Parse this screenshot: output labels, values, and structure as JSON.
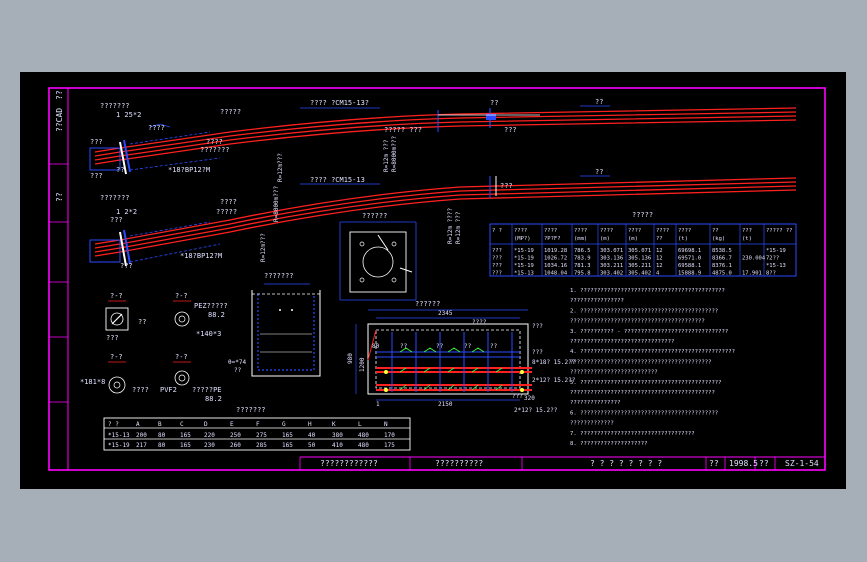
{
  "colors": {
    "frame": "#ff00ff",
    "cable": "#ff2020",
    "dim": "#2a4bff",
    "text": "#e0e0ff",
    "green": "#3cff3c",
    "yellow": "#ffff40",
    "white": "#ffffff",
    "bg": "#000000"
  },
  "side_titles": [
    "??CAD",
    "??",
    "??"
  ],
  "top_labels": {
    "a1": "???????",
    "a2": "1 25*2",
    "a3": "?????",
    "a4": "????",
    "a5": "????",
    "a6": "???????",
    "a7": "???? ?CM15-13?",
    "a8": "????? ???",
    "a9": "???",
    "a10": "*18?BP12?M",
    "a11": "???",
    "a12": "??",
    "a13": "??",
    "a14": "???",
    "a15": "??"
  },
  "mid_labels": {
    "b1": "???????",
    "b2": "1 2*2",
    "b3": "????",
    "b4": "?????",
    "b5": "???? ?CM15-13",
    "b6": "???",
    "b7": "???",
    "b8": "*18?BP12?M",
    "b9": "???",
    "b10": "??"
  },
  "vertical_labels": [
    "R=12m???",
    "R=12m ???",
    "R=8000m???",
    "R=12m???",
    "R=12m ????",
    "R=12m ???",
    "R=8000m???"
  ],
  "plate_label": "??????",
  "sections": {
    "s1": "?-?",
    "s2": "?-?",
    "s3": "?-?",
    "s4": "?-?",
    "s1a": "???",
    "s1b": "??",
    "s2a": "PEZ?????",
    "s2b": "88.2",
    "s2c": "*140*3",
    "s3a": "*181*8",
    "s3b": "????",
    "s4a": "PVF2",
    "s4b": "?????PE",
    "s4c": "88.2",
    "tub_title": "???????",
    "tub_a": "θ=*74",
    "tub_b": "??"
  },
  "plan_title": "??????",
  "plan_dims": [
    "2345",
    "2150",
    "980",
    "1200",
    "320"
  ],
  "plan_labels": [
    "????",
    "??",
    "??",
    "??",
    "??",
    "80",
    "8*18? 15.2??",
    "2*12? 15.2??",
    "2*12? 15.2??",
    "???",
    "1",
    "???",
    "???"
  ],
  "top_table": {
    "title": "?????",
    "headers": [
      "? ?",
      "????",
      "????",
      "????",
      "????",
      "????",
      "????",
      "????",
      "??",
      "???",
      "????? ??"
    ],
    "units": [
      "",
      "(MP?)",
      "?P?F?",
      "(mm)",
      "(m)",
      "(m)",
      "??",
      "(t)",
      "(kg)",
      "(t)",
      ""
    ],
    "rows": [
      [
        "???",
        "*15-19",
        "1019.28",
        "786.5",
        "303.071",
        "305.071",
        "12",
        "69698.1",
        "8538.5",
        "",
        "*15-19"
      ],
      [
        "???",
        "*15-19",
        "1026.72",
        "783.9",
        "303.136",
        "305.136",
        "12",
        "69571.0",
        "8366.7",
        "230.004",
        "72??"
      ],
      [
        "???",
        "*15-19",
        "1034.16",
        "781.3",
        "303.211",
        "305.211",
        "12",
        "69588.1",
        "8376.1",
        "",
        "*15-13"
      ],
      [
        "???",
        "*15-13",
        "1048.04",
        "795.8",
        "303.402",
        "305.402",
        "4",
        "15888.9",
        "4875.0",
        "17.901",
        "8??"
      ]
    ]
  },
  "notes": [
    "1. ???????????????????????????????????????????",
    "   ????????????????",
    "2. ?????????????????????????????????????????",
    "   ????????????????????????????????????????",
    "3. ?????????? - ???????????????????????????????",
    "   ???????????????????????????????",
    "4. ??????????????????????????????????????????????",
    "   ??????????????????????????????????????????",
    "   ??????????????????????????",
    "5. ??????????????????????????????????????????",
    "   ???????????????????????????????????????????",
    "   ???????????????",
    "6. ?????????????????????????????????????????",
    "   ?????????????",
    "7. ??????????????????????????????????",
    "8. ????????????????????"
  ],
  "bottom_table": {
    "title": "???????",
    "headers": [
      "? ?",
      "A",
      "B",
      "C",
      "D",
      "E",
      "F",
      "G",
      "H",
      "K",
      "L",
      "N"
    ],
    "rows": [
      [
        "*15-13",
        "200",
        "80",
        "165",
        "220",
        "250",
        "275",
        "165",
        "40",
        "380",
        "480",
        "170"
      ],
      [
        "*15-19",
        "217",
        "80",
        "165",
        "230",
        "260",
        "285",
        "165",
        "50",
        "410",
        "480",
        "175"
      ]
    ]
  },
  "title_block": {
    "name1": "????????????",
    "name2": "??????????",
    "blank": "? ? ? ? ? ? ? ?",
    "c1": "??",
    "date": "1998.5",
    "c2": "??",
    "code": "SZ-1-54"
  }
}
